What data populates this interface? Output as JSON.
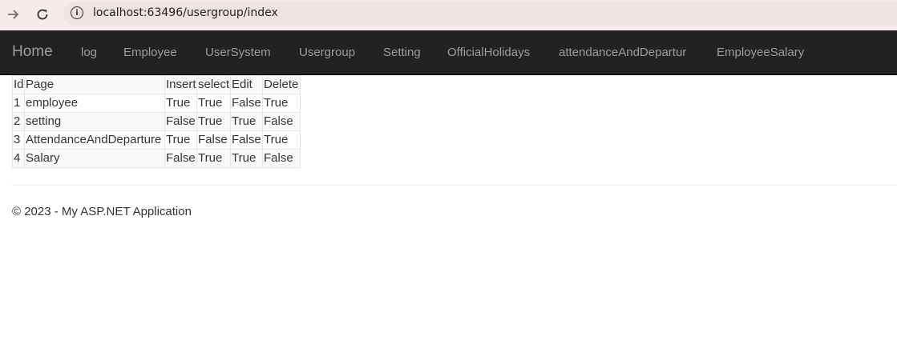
{
  "browser": {
    "url": "localhost:63496/usergroup/index",
    "back_icon": "→",
    "reload_icon": "C"
  },
  "navbar": {
    "brand": "Home",
    "links": [
      "log",
      "Employee",
      "UserSystem",
      "Usergroup",
      "Setting",
      "OfficialHolidays",
      "attendanceAndDepartur",
      "EmployeeSalary"
    ]
  },
  "table": {
    "headers": [
      "Id",
      "Page",
      "Insert",
      "select",
      "Edit",
      "Delete"
    ],
    "rows": [
      [
        "1",
        "employee",
        "True",
        "True",
        "False",
        "True"
      ],
      [
        "2",
        "setting",
        "False",
        "True",
        "True",
        "False"
      ],
      [
        "3",
        "AttendanceAndDeparture",
        "True",
        "False",
        "False",
        "True"
      ],
      [
        "4",
        "Salary",
        "False",
        "True",
        "True",
        "False"
      ]
    ]
  },
  "footer": {
    "text": "© 2023 - My ASP.NET Application"
  }
}
